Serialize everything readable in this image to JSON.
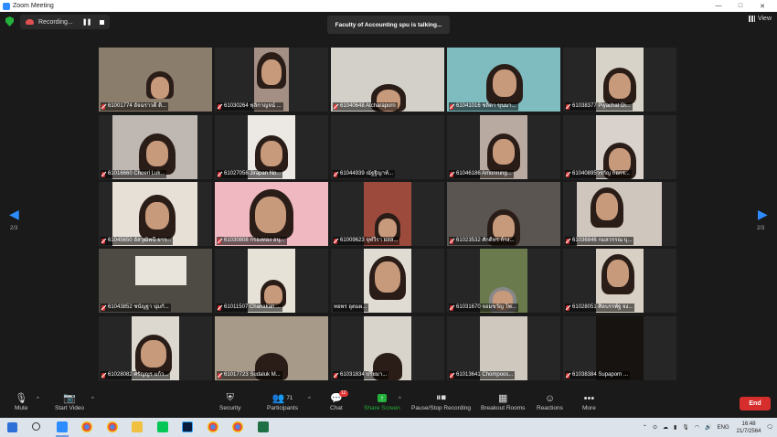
{
  "window": {
    "title": "Zoom Meeting",
    "minimize": "—",
    "maximize": "□",
    "close": "✕"
  },
  "recording": {
    "label": "Recording...",
    "pause": "❚❚"
  },
  "speaker_banner": "Faculty of Accounting spu is talking...",
  "view_label": "View",
  "page_left": "2/3",
  "page_right": "2/3",
  "participants": [
    "61001774 อัจฉราวดี ติ...",
    "61030264 ฟุลิกาญจน์ ...",
    "61040648 Atcharaporn",
    "61041016 ชลิดา ขุนมา...",
    "61038377 Piyachat Di...",
    "61016660 Choeri Luk...",
    "61027056 Jirapan No...",
    "61044939 ณัฐฐิญาท์...",
    "61046186 Amonrung...",
    "61040895วรกัญ ก็อกร...",
    "61045650 อัสวุฒิพนี ยาว...",
    "61030808 กรองทอง อนุ...",
    "61009623 จุฬวีรา ผลส...",
    "61023532 ศักดิ์ทร ก้าง...",
    "61036846 กมลวรรณ บุ...",
    "61043852 ชนัญฐา นุ่มกั...",
    "61011507 Chanakan ...",
    "ทอพร อุดมผ...",
    "61031670 จอมขวัญ โพ...",
    "61028051 ศิลบรรพัฐ จง...",
    "61028082 ศรัญญร แก้ว...",
    "61017723 Sudaluk M...",
    "61031834 ปรียมา...",
    "61013641 Chompoos...",
    "61038384 Supaporn ..."
  ],
  "toolbar": {
    "mute": "Mute",
    "start_video": "Start Video",
    "security": "Security",
    "participants": "Participants",
    "participants_count": "71",
    "chat": "Chat",
    "chat_badge": "12",
    "share_screen": "Share Screen",
    "pause_stop_recording": "Pause/Stop Recording",
    "breakout_rooms": "Breakout Rooms",
    "reactions": "Reactions",
    "more": "More",
    "end": "End"
  },
  "tray": {
    "lang": "ENG",
    "time": "16:48",
    "date": "21/7/2564"
  },
  "colors": {
    "accent": "#2d8cff",
    "end": "#d62d2d",
    "share": "#23b13b",
    "muted": "#e03333"
  }
}
